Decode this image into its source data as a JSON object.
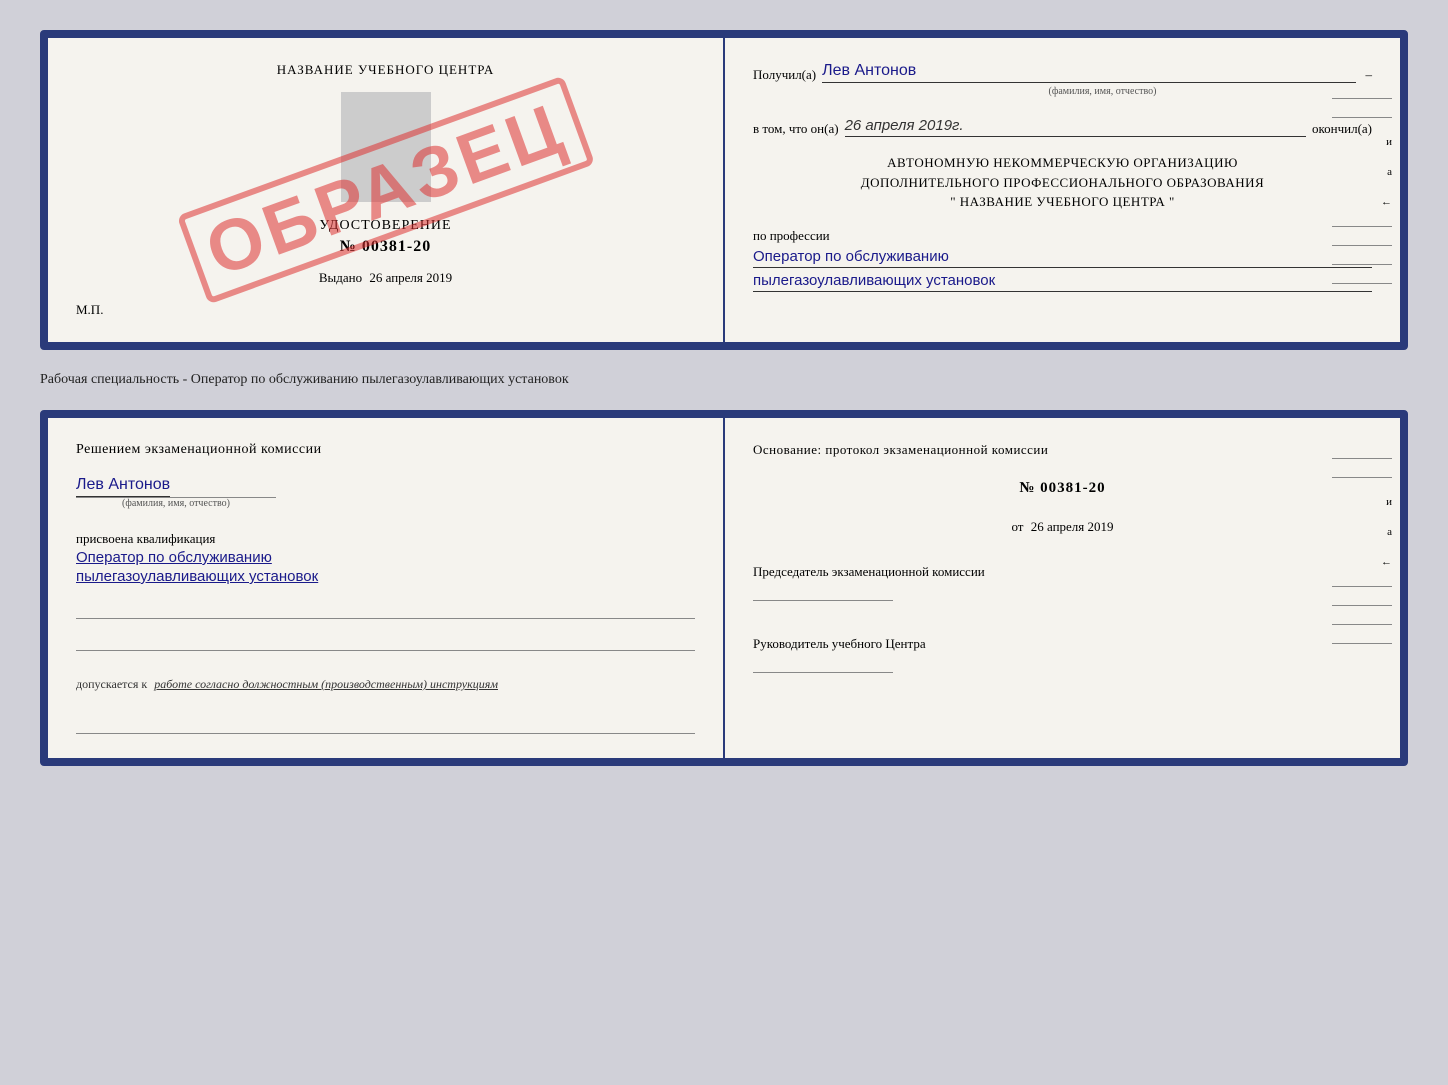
{
  "top_card": {
    "left": {
      "center_title": "НАЗВАНИЕ УЧЕБНОГО ЦЕНТРА",
      "stamp_text": "ОБРАЗЕЦ",
      "cert_title": "УДОСТОВЕРЕНИЕ",
      "cert_number": "№ 00381-20",
      "issued_label": "Выдано",
      "issued_date": "26 апреля 2019",
      "mp_label": "М.П."
    },
    "right": {
      "received_label": "Получил(а)",
      "received_name": "Лев Антонов",
      "name_sub": "(фамилия, имя, отчество)",
      "completed_prefix": "в том, что он(а)",
      "completed_date": "26 апреля 2019г.",
      "completed_suffix": "окончил(а)",
      "org_line1": "АВТОНОМНУЮ НЕКОММЕРЧЕСКУЮ ОРГАНИЗАЦИЮ",
      "org_line2": "ДОПОЛНИТЕЛЬНОГО ПРОФЕССИОНАЛЬНОГО ОБРАЗОВАНИЯ",
      "org_line3": "\"    НАЗВАНИЕ УЧЕБНОГО ЦЕНТРА    \"",
      "profession_label": "по профессии",
      "profession_line1": "Оператор по обслуживанию",
      "profession_line2": "пылегазоулавливающих установок"
    }
  },
  "separator": {
    "text": "Рабочая специальность - Оператор по обслуживанию пылегазоулавливающих установок"
  },
  "bottom_card": {
    "left": {
      "decision_text": "Решением экзаменационной комиссии",
      "person_name": "Лев Антонов",
      "name_sub": "(фамилия, имя, отчество)",
      "qualification_label": "присвоена квалификация",
      "qualification_line1": "Оператор по обслуживанию",
      "qualification_line2": "пылегазоулавливающих установок",
      "allow_prefix": "допускается к",
      "allow_value": "работе согласно должностным (производственным) инструкциям"
    },
    "right": {
      "basis_text": "Основание: протокол экзаменационной комиссии",
      "protocol_number": "№ 00381-20",
      "protocol_date_prefix": "от",
      "protocol_date": "26 апреля 2019",
      "chairman_label": "Председатель экзаменационной комиссии",
      "head_label": "Руководитель учебного Центра"
    }
  },
  "side_marks": {
    "и": "и",
    "а": "а",
    "left_arrow": "←"
  }
}
